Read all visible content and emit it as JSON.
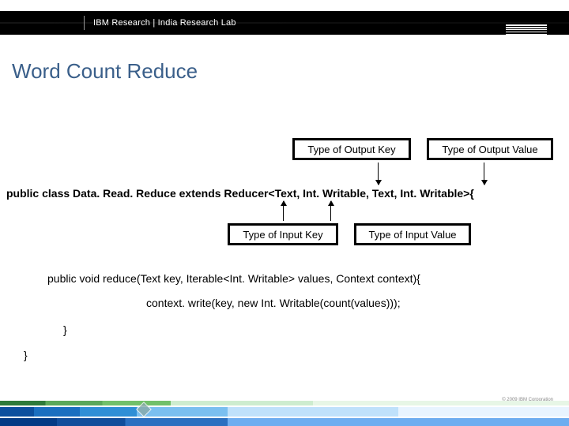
{
  "header": {
    "org": "IBM Research",
    "sep": "  |  ",
    "lab": "India Research Lab"
  },
  "title": "Word Count Reduce",
  "annotations": {
    "output_key": "Type of Output Key",
    "output_value": "Type of Output Value",
    "input_key": "Type of Input Key",
    "input_value": "Type of Input Value"
  },
  "code": {
    "class_sig": "public class Data. Read. Reduce extends Reducer<Text, Int. Writable, Text, Int. Writable>{",
    "method_sig": "public void reduce(Text key, Iterable<Int. Writable> values, Context context){",
    "body_line": "context. write(key, new Int. Writable(count(values)));",
    "close_method": "}",
    "close_class": "}"
  },
  "footer": {
    "copyright": "© 2009 IBM Corporation"
  }
}
